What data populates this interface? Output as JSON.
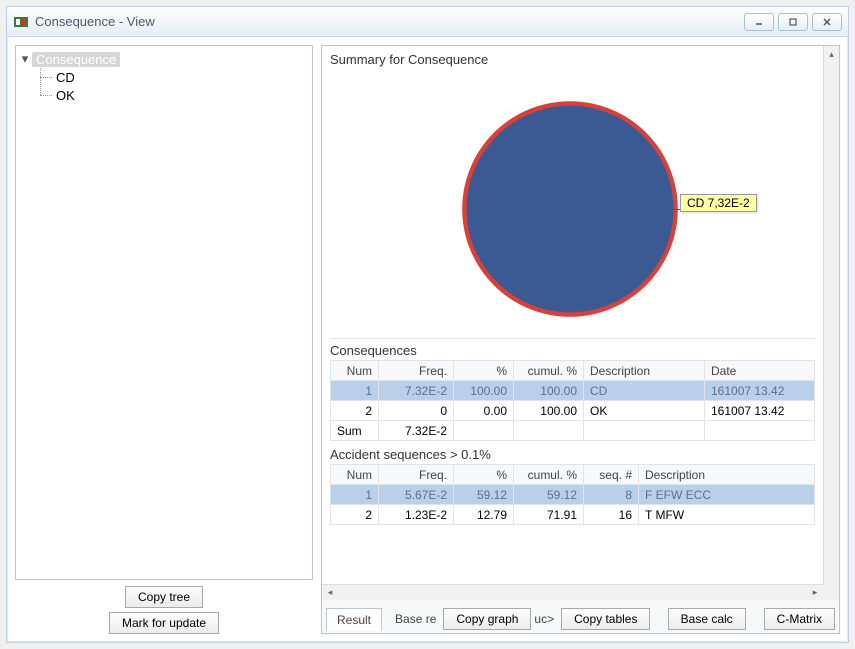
{
  "window": {
    "title": "Consequence  - View"
  },
  "tree": {
    "root": "Consequence",
    "children": [
      "CD",
      "OK"
    ]
  },
  "left_buttons": {
    "copy_tree": "Copy tree",
    "mark_update": "Mark for update"
  },
  "summary": {
    "heading": "Summary for Consequence"
  },
  "chart_data": {
    "type": "pie",
    "title": "",
    "slices": [
      {
        "name": "CD",
        "value": 0.0732,
        "percent": 100.0,
        "color": "#3b5a93",
        "stroke": "#d8413a"
      }
    ],
    "label": "CD 7,32E-2"
  },
  "consequences": {
    "title": "Consequences",
    "headers": {
      "num": "Num",
      "freq": "Freq.",
      "pct": "%",
      "cum": "cumul. %",
      "desc": "Description",
      "date": "Date"
    },
    "rows": [
      {
        "num": "1",
        "freq": "7.32E-2",
        "pct": "100.00",
        "cum": "100.00",
        "desc": "CD",
        "date": "161007 13.42",
        "selected": true
      },
      {
        "num": "2",
        "freq": "0",
        "pct": "0.00",
        "cum": "100.00",
        "desc": "OK",
        "date": "161007 13.42"
      }
    ],
    "sum_label": "Sum",
    "sum_freq": "7.32E-2"
  },
  "accident": {
    "title": "Accident sequences > 0.1%",
    "headers": {
      "num": "Num",
      "freq": "Freq.",
      "pct": "%",
      "cum": "cumul. %",
      "seq": "seq. #",
      "desc": "Description"
    },
    "rows": [
      {
        "num": "1",
        "freq": "5.67E-2",
        "pct": "59.12",
        "cum": "59.12",
        "seq": "8",
        "desc": "F EFW ECC",
        "selected": true
      },
      {
        "num": "2",
        "freq": "1.23E-2",
        "pct": "12.79",
        "cum": "71.91",
        "seq": "16",
        "desc": "T MFW"
      }
    ]
  },
  "tabs": {
    "result": "Result",
    "base_re": "Base re",
    "copy_graph": "Copy graph",
    "uc_frag": "uc>",
    "copy_tables": "Copy tables",
    "base_calc": "Base calc",
    "c_matrix": "C-Matrix"
  }
}
